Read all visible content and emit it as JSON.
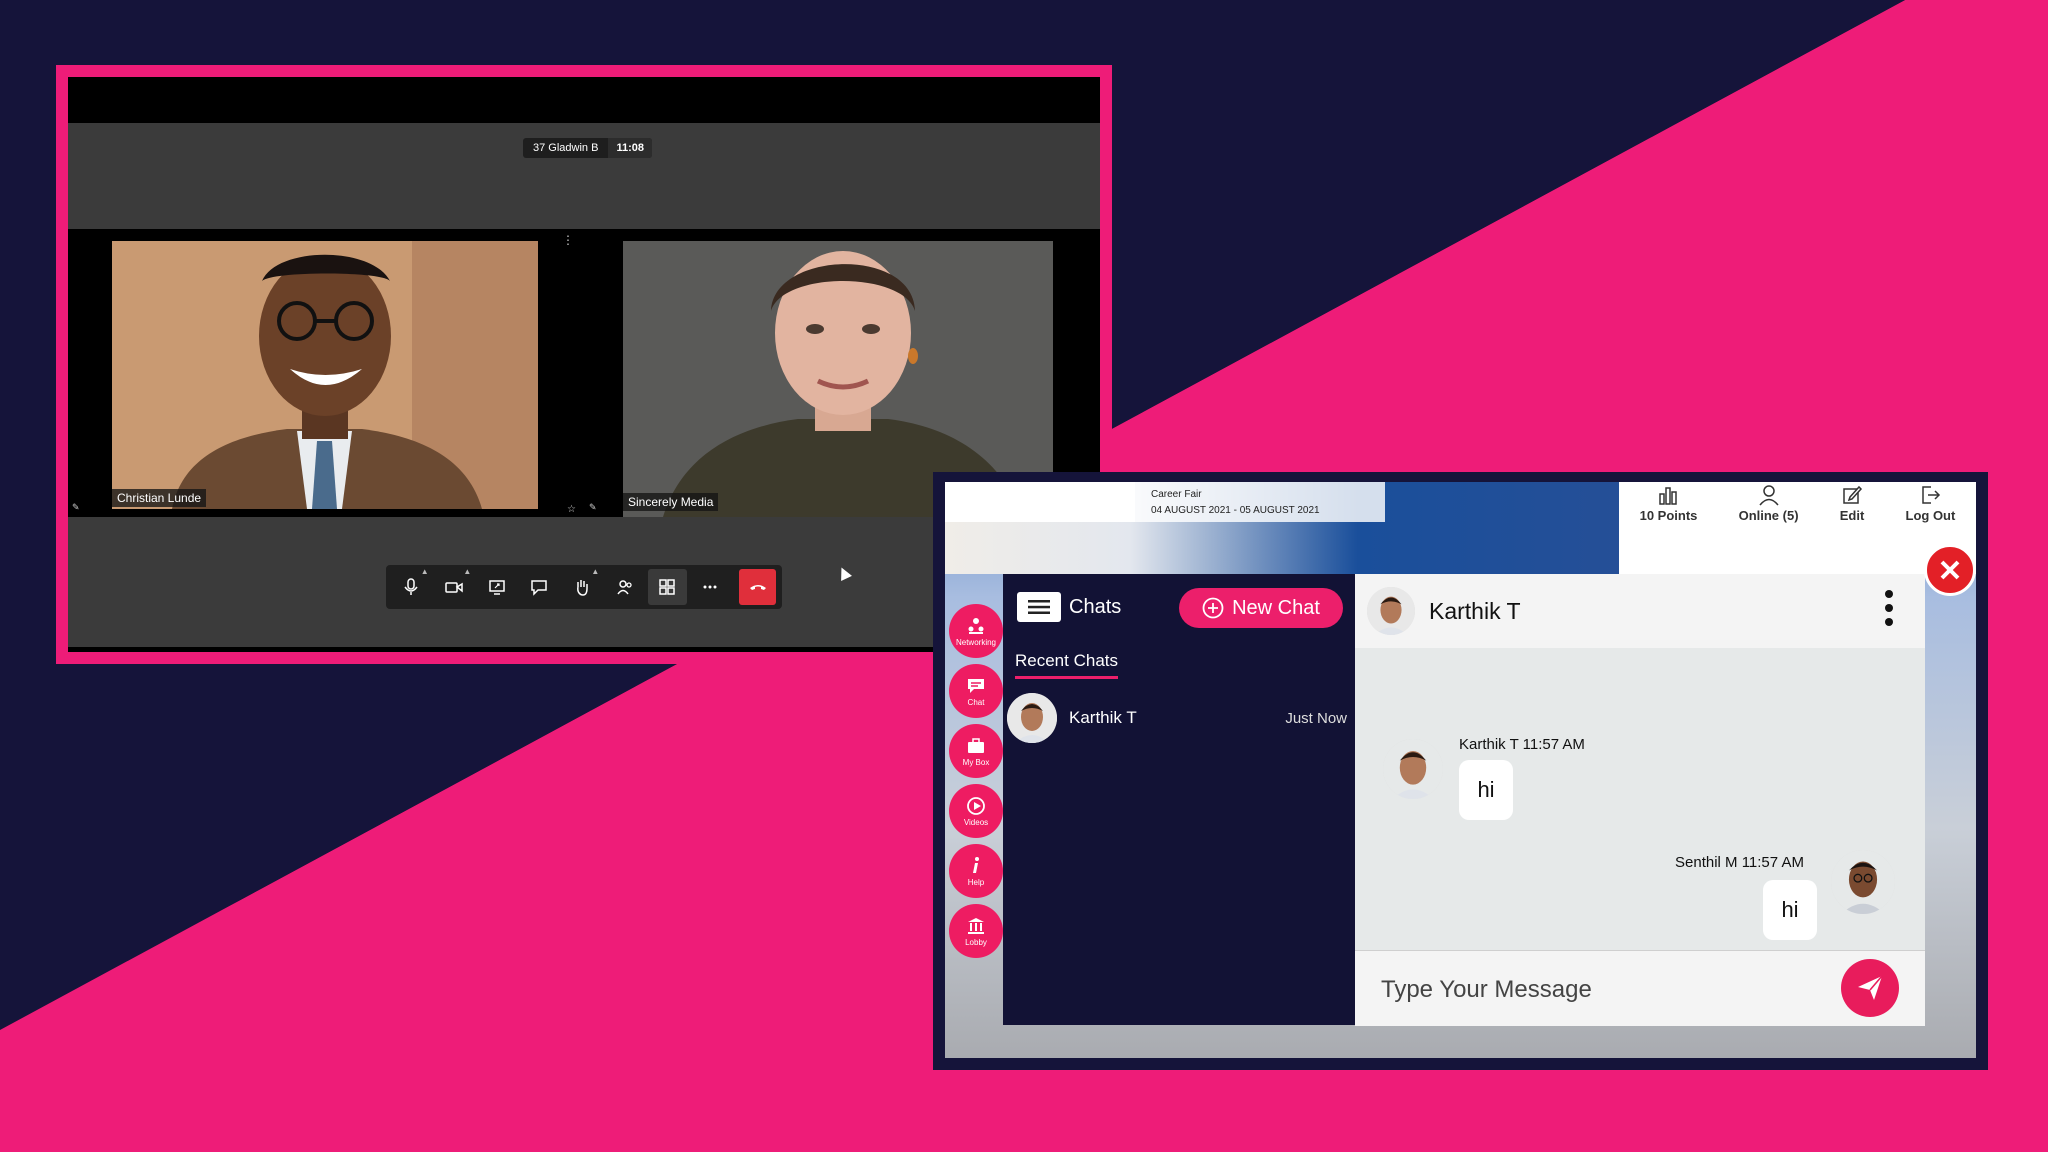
{
  "colors": {
    "background": "#15143a",
    "accent": "#ee1c78",
    "hangup": "#e02f3b",
    "close": "#e32027"
  },
  "video_call": {
    "meeting_name": "37 Gladwin B",
    "meeting_time": "11:08",
    "participants": [
      {
        "name": "Christian Lunde"
      },
      {
        "name": "Sincerely Media"
      }
    ],
    "toolbar_icons": [
      "mic-icon",
      "camera-icon",
      "share-screen-icon",
      "chat-icon",
      "raise-hand-icon",
      "participants-icon",
      "grid-view-icon",
      "more-icon",
      "hang-up-icon"
    ]
  },
  "chat_app": {
    "event": {
      "title": "Career Fair",
      "dates": "04 AUGUST 2021 - 05 AUGUST 2021"
    },
    "top_menu": [
      {
        "label": "10 Points",
        "icon": "bar-chart-icon"
      },
      {
        "label": "Online (5)",
        "icon": "user-icon"
      },
      {
        "label": "Edit",
        "icon": "edit-icon"
      },
      {
        "label": "Log Out",
        "icon": "logout-icon"
      }
    ],
    "side_nav": [
      {
        "label": "Networking",
        "icon": "networking-icon"
      },
      {
        "label": "Chat",
        "icon": "chat-icon"
      },
      {
        "label": "My Box",
        "icon": "briefcase-icon"
      },
      {
        "label": "Videos",
        "icon": "play-icon"
      },
      {
        "label": "Help",
        "icon": "info-icon"
      },
      {
        "label": "Lobby",
        "icon": "lobby-icon"
      }
    ],
    "chats_title": "Chats",
    "new_chat_label": "New Chat",
    "recent_chats_label": "Recent Chats",
    "recent_chats": [
      {
        "name": "Karthik T",
        "time": "Just Now"
      }
    ],
    "conversation": {
      "contact_name": "Karthik T",
      "messages": [
        {
          "sender": "Karthik T",
          "time": "11:57 AM",
          "meta": "Karthik T 11:57 AM",
          "text": "hi",
          "incoming": true
        },
        {
          "sender": "Senthil M",
          "time": "11:57 AM",
          "meta": "Senthil M 11:57 AM",
          "text": "hi",
          "incoming": false
        }
      ],
      "input_placeholder": "Type Your Message"
    }
  }
}
